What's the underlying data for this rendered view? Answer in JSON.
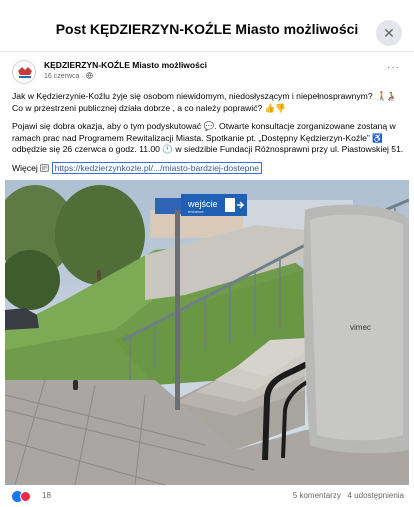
{
  "header": {
    "title": "Post KĘDZIERZYN-KOŹLE Miasto możliwości",
    "close_symbol": "✕"
  },
  "post": {
    "author": "KĘDZIERZYN-KOŹLE Miasto możliwości",
    "date": "16 czerwca",
    "privacy_icon": "globe-icon",
    "more_symbol": "···",
    "paragraph1": "Jak w Kędzierzynie-Koźlu żyje się osobom niewidomym, niedosłyszącym i niepełnosprawnym? 🧑‍🦯👨‍🦽 Co w przestrzeni publicznej działa dobrze , a co należy poprawić? 👍👎",
    "paragraph2": "Pojawi się dobra okazja, aby o tym podyskutować 💬. Otwarte konsultacje zorganizowane zostaną w ramach prac nad Programem Rewitalizacji Miasta. Spotkanie pt. „Dostępny Kędzierzyn-Koźle” ♿ odbędzie się 26 czerwca o godz. 11.00 🕚 w siedzibie Fundacji Różnosprawni przy ul. Piastowskiej 51.",
    "more_label": "Więcej",
    "link_icon": "link-icon",
    "link_text": "https://kedzierzynkozle.pl/.../miasto-bardziej-dostepne"
  },
  "photo": {
    "sign_text": "wejście",
    "sign_subtext": "entrance",
    "lift_brand": "vimec"
  },
  "footer": {
    "reaction_count": "18",
    "comments": "5 komentarzy",
    "shares": "4 udostępnienia"
  },
  "colors": {
    "link": "#385898",
    "sign_blue": "#1f5fb4",
    "like_blue": "#1877f2",
    "love_red": "#f0284a"
  }
}
